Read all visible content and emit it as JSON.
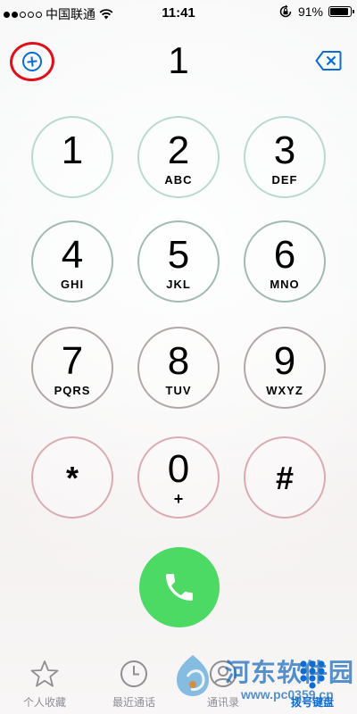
{
  "status_bar": {
    "signal_dots": [
      true,
      true,
      false,
      false,
      false
    ],
    "carrier": "中国联通",
    "time": "11:41",
    "battery_percent": "91%",
    "battery_level": 0.91,
    "icons": [
      "wifi-icon",
      "rotation-lock-icon",
      "battery-icon"
    ]
  },
  "dialer": {
    "dialed_number": "1",
    "add_contact_icon": "plus-circle-icon",
    "delete_icon": "delete-backspace-icon"
  },
  "keypad": {
    "keys": [
      {
        "digit": "1",
        "letters": ""
      },
      {
        "digit": "2",
        "letters": "ABC"
      },
      {
        "digit": "3",
        "letters": "DEF"
      },
      {
        "digit": "4",
        "letters": "GHI"
      },
      {
        "digit": "5",
        "letters": "JKL"
      },
      {
        "digit": "6",
        "letters": "MNO"
      },
      {
        "digit": "7",
        "letters": "PQRS"
      },
      {
        "digit": "8",
        "letters": "TUV"
      },
      {
        "digit": "9",
        "letters": "WXYZ"
      },
      {
        "digit": "*",
        "letters": ""
      },
      {
        "digit": "0",
        "letters": "+"
      },
      {
        "digit": "#",
        "letters": ""
      }
    ],
    "call_icon": "phone-icon",
    "call_color": "#4cd964"
  },
  "tab_bar": {
    "tabs": [
      {
        "label": "个人收藏",
        "icon": "star-icon",
        "active": false
      },
      {
        "label": "最近通话",
        "icon": "clock-icon",
        "active": false
      },
      {
        "label": "通讯录",
        "icon": "contacts-icon",
        "active": false
      },
      {
        "label": "拨号键盘",
        "icon": "keypad-icon",
        "active": true
      }
    ],
    "active_color": "#0a6cd6",
    "inactive_color": "#8e8e93"
  },
  "watermark": {
    "text": "河东软件园",
    "url": "www.pc0359.cn"
  },
  "colors": {
    "accent": "#0a6cd6",
    "annotation_circle": "#e0101a"
  }
}
